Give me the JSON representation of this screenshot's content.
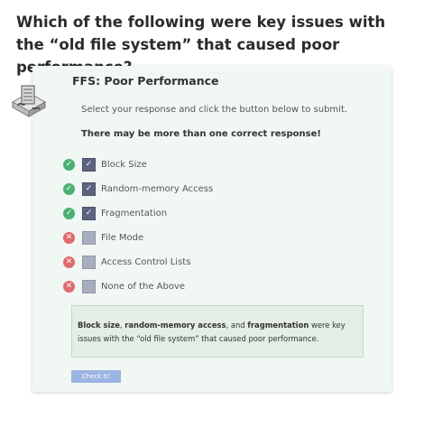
{
  "question": "Which of the following were key issues with the “old file system” that caused poor performance?",
  "card": {
    "title": "FFS: Poor Performance",
    "instructions": "Select your response and click the button below to submit.",
    "hint": "There may be more than one correct response!"
  },
  "options": [
    {
      "label": "Block Size",
      "checked": true,
      "correct": true,
      "icon": "check-circle-icon"
    },
    {
      "label": "Random-memory Access",
      "checked": true,
      "correct": true,
      "icon": "check-circle-icon"
    },
    {
      "label": "Fragmentation",
      "checked": true,
      "correct": true,
      "icon": "check-circle-icon"
    },
    {
      "label": "File Mode",
      "checked": false,
      "correct": false,
      "icon": "x-circle-icon"
    },
    {
      "label": "Access Control Lists",
      "checked": false,
      "correct": false,
      "icon": "x-circle-icon"
    },
    {
      "label": "None of the Above",
      "checked": false,
      "correct": false,
      "icon": "x-circle-icon"
    }
  ],
  "feedback": {
    "term1": "Block size",
    "sep1": ", ",
    "term2": "random-memory access",
    "sep2": ", and ",
    "term3": "fragmentation",
    "rest": " were key issues with the “old file system” that caused poor performance."
  },
  "button": {
    "label": "Check It!"
  },
  "colors": {
    "card_bg": "#f1f7f3",
    "correct": "#4caf73",
    "incorrect": "#e06a6e",
    "checked_box": "#5c6280",
    "unchecked_box": "#a8aebf",
    "feedback_bg": "#e3eee4",
    "button_bg": "#9cb4e3"
  }
}
